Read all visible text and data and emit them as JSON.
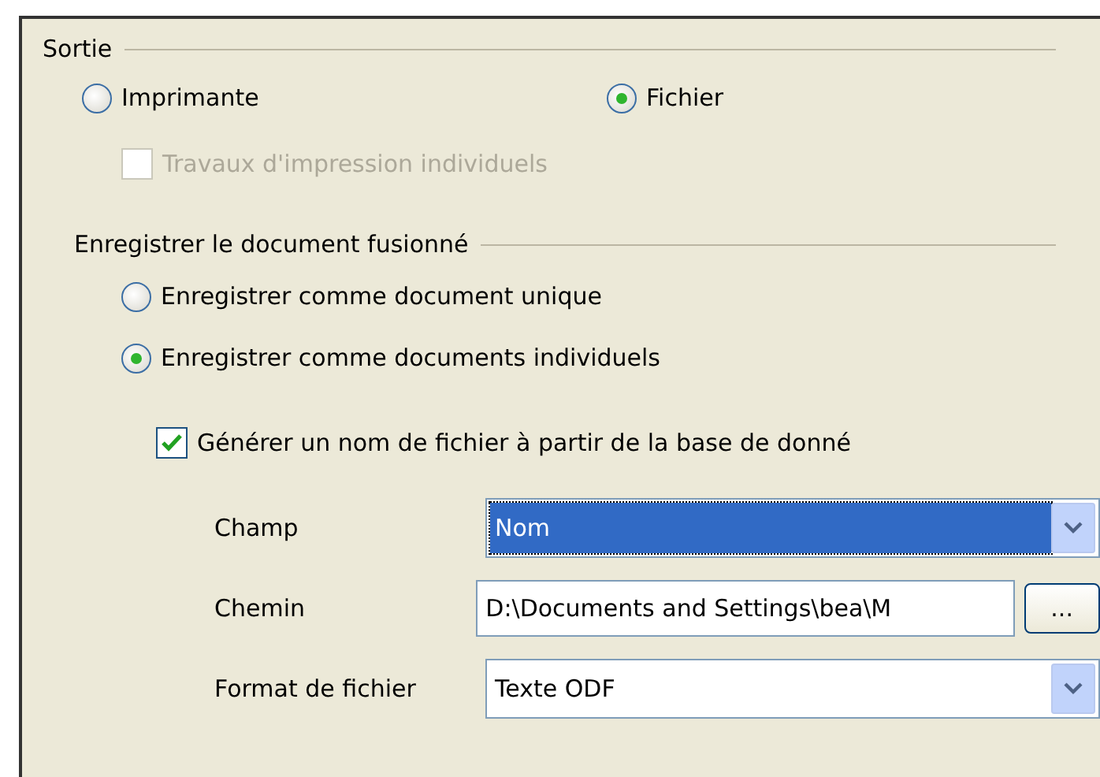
{
  "output": {
    "title": "Sortie",
    "options": [
      {
        "label": "Imprimante",
        "selected": false
      },
      {
        "label": "Fichier",
        "selected": true
      }
    ],
    "separate_jobs": {
      "label": "Travaux d'impression individuels",
      "checked": false,
      "disabled": true
    }
  },
  "save": {
    "title": "Enregistrer le document fusionné",
    "options": [
      {
        "label": "Enregistrer comme document unique",
        "selected": false
      },
      {
        "label": "Enregistrer comme documents individuels",
        "selected": true
      }
    ],
    "generate_name": {
      "label": "Générer un nom de fichier à partir de la base de donné",
      "checked": true,
      "disabled": false
    },
    "fields": [
      {
        "kind": "dropdown",
        "label": "Champ",
        "value": "Nom",
        "focused": true
      },
      {
        "kind": "path",
        "label": "Chemin",
        "value": "D:\\Documents and Settings\\bea\\M",
        "button": "..."
      },
      {
        "kind": "dropdown",
        "label": "Format de fichier",
        "value": "Texte ODF",
        "focused": false
      }
    ]
  }
}
